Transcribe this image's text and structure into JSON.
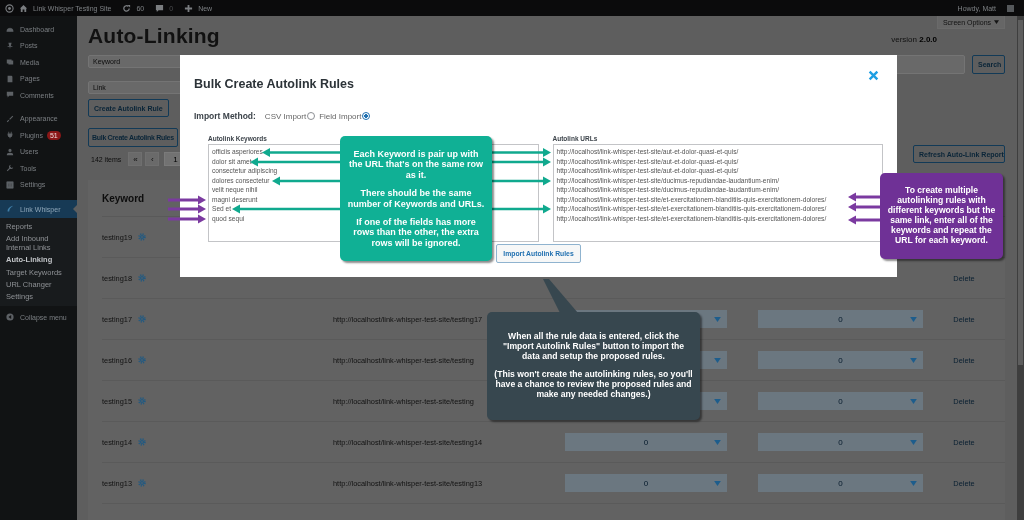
{
  "admin_bar": {
    "site_name": "Link Whisper Testing Site",
    "updates": "60",
    "comments": "0",
    "new": "New",
    "greeting": "Howdy, Matt"
  },
  "sidebar": {
    "items": [
      {
        "label": "Dashboard",
        "selected": false
      },
      {
        "label": "Posts",
        "selected": false
      },
      {
        "label": "Media",
        "selected": false
      },
      {
        "label": "Pages",
        "selected": false
      },
      {
        "label": "Comments",
        "selected": false
      },
      {
        "label": "Appearance",
        "selected": false
      },
      {
        "label": "Plugins",
        "badge": "51",
        "selected": false
      },
      {
        "label": "Users",
        "selected": false
      },
      {
        "label": "Tools",
        "selected": false
      },
      {
        "label": "Settings",
        "selected": false
      },
      {
        "label": "Link Whisper",
        "selected": true
      }
    ],
    "submenu": [
      {
        "label": "Reports",
        "selected": false
      },
      {
        "label": "Add Inbound Internal Links",
        "selected": false
      },
      {
        "label": "Auto-Linking",
        "selected": true
      },
      {
        "label": "Target Keywords",
        "selected": false
      },
      {
        "label": "URL Changer",
        "selected": false
      },
      {
        "label": "Settings",
        "selected": false
      }
    ],
    "collapse": "Collapse menu"
  },
  "page": {
    "title": "Auto-Linking",
    "screen_options": "Screen Options",
    "version_label": "version",
    "version": "2.0.0",
    "keyword_field": {
      "placeholder": "Keyword"
    },
    "link_field": {
      "placeholder": "Link"
    },
    "search_button": "Search",
    "create_button": "Create Autolink Rule",
    "bulk_button": "Bulk Create Autolink Rules",
    "refresh_button": "Refresh Auto-Link Report",
    "pagination": {
      "count": "142 items",
      "first": "«",
      "prev": "‹",
      "page": "1"
    }
  },
  "table": {
    "columns": [
      "Keyword"
    ],
    "rows": [
      {
        "keyword": "testing19"
      },
      {
        "keyword": "testing18",
        "delete": "Delete"
      },
      {
        "keyword": "testing17",
        "url": "http://localhost/link-whisper-test-site/testing17",
        "select_2": "0",
        "delete": "Delete"
      },
      {
        "keyword": "testing16",
        "url": "http://localhost/link-whisper-test-site/testing",
        "select_2": "0",
        "delete": "Delete"
      },
      {
        "keyword": "testing15",
        "url": "http://localhost/link-whisper-test-site/testing",
        "select_2": "0",
        "delete": "Delete"
      },
      {
        "keyword": "testing14",
        "url": "http://localhost/link-whisper-test-site/testing14",
        "select_1": "0",
        "select_2": "0",
        "delete": "Delete"
      },
      {
        "keyword": "testing13",
        "url": "http://localhost/link-whisper-test-site/testing13",
        "select_1": "0",
        "select_2": "0",
        "delete": "Delete"
      }
    ]
  },
  "modal": {
    "title": "Bulk Create Autolink Rules",
    "import_method": {
      "label": "Import Method:",
      "options": [
        {
          "label": "CSV Import",
          "selected": false
        },
        {
          "label": "Field Import",
          "selected": true
        }
      ]
    },
    "keywords": {
      "label": "Autolink Keywords",
      "lines": [
        "officiis asperiores",
        "dolor sit amet",
        "consectetur adipiscing",
        "dolores consectetur",
        "velit neque nihil",
        "magni deserunt",
        "Sed et",
        "quod sequi"
      ]
    },
    "urls": {
      "label": "Autolink URLs",
      "lines": [
        "http://localhost/link-whisper-test-site/aut-et-dolor-quasi-et-quis/",
        "http://localhost/link-whisper-test-site/aut-et-dolor-quasi-et-quis/",
        "http://localhost/link-whisper-test-site/aut-et-dolor-quasi-et-quis/",
        "http://localhost/link-whisper-test-site/ducimus-repudiandae-laudantium-enim/",
        "http://localhost/link-whisper-test-site/ducimus-repudiandae-laudantium-enim/",
        "http://localhost/link-whisper-test-site/et-exercitationem-blanditiis-quis-exercitationem-dolores/",
        "http://localhost/link-whisper-test-site/et-exercitationem-blanditiis-quis-exercitationem-dolores/",
        "http://localhost/link-whisper-test-site/et-exercitationem-blanditiis-quis-exercitationem-dolores/"
      ]
    },
    "import_button": "Import Autolink Rules"
  },
  "callouts": [
    {
      "color": "#10b095",
      "paragraphs": [
        "Each Keyword is pair up with the URL that's on the same row as it.",
        "There should be the same number of Keywords and URLs.",
        "If one of the fields has more rows than the other, the extra rows will be ignored."
      ]
    },
    {
      "color": "#6f3196",
      "paragraphs": [
        "To create multiple autolinking rules with different keywords but the same link, enter all of the keywords and repeat the URL for each keyword."
      ]
    },
    {
      "color": "#37474f",
      "paragraphs": [
        "When all the rule data is entered, click the \"Import Autolink Rules\" button to import the data and setup the proposed rules.",
        "(This won't create the autolinking rules, so you'll have a chance to review the proposed rules and make any needed changes.)"
      ]
    }
  ]
}
